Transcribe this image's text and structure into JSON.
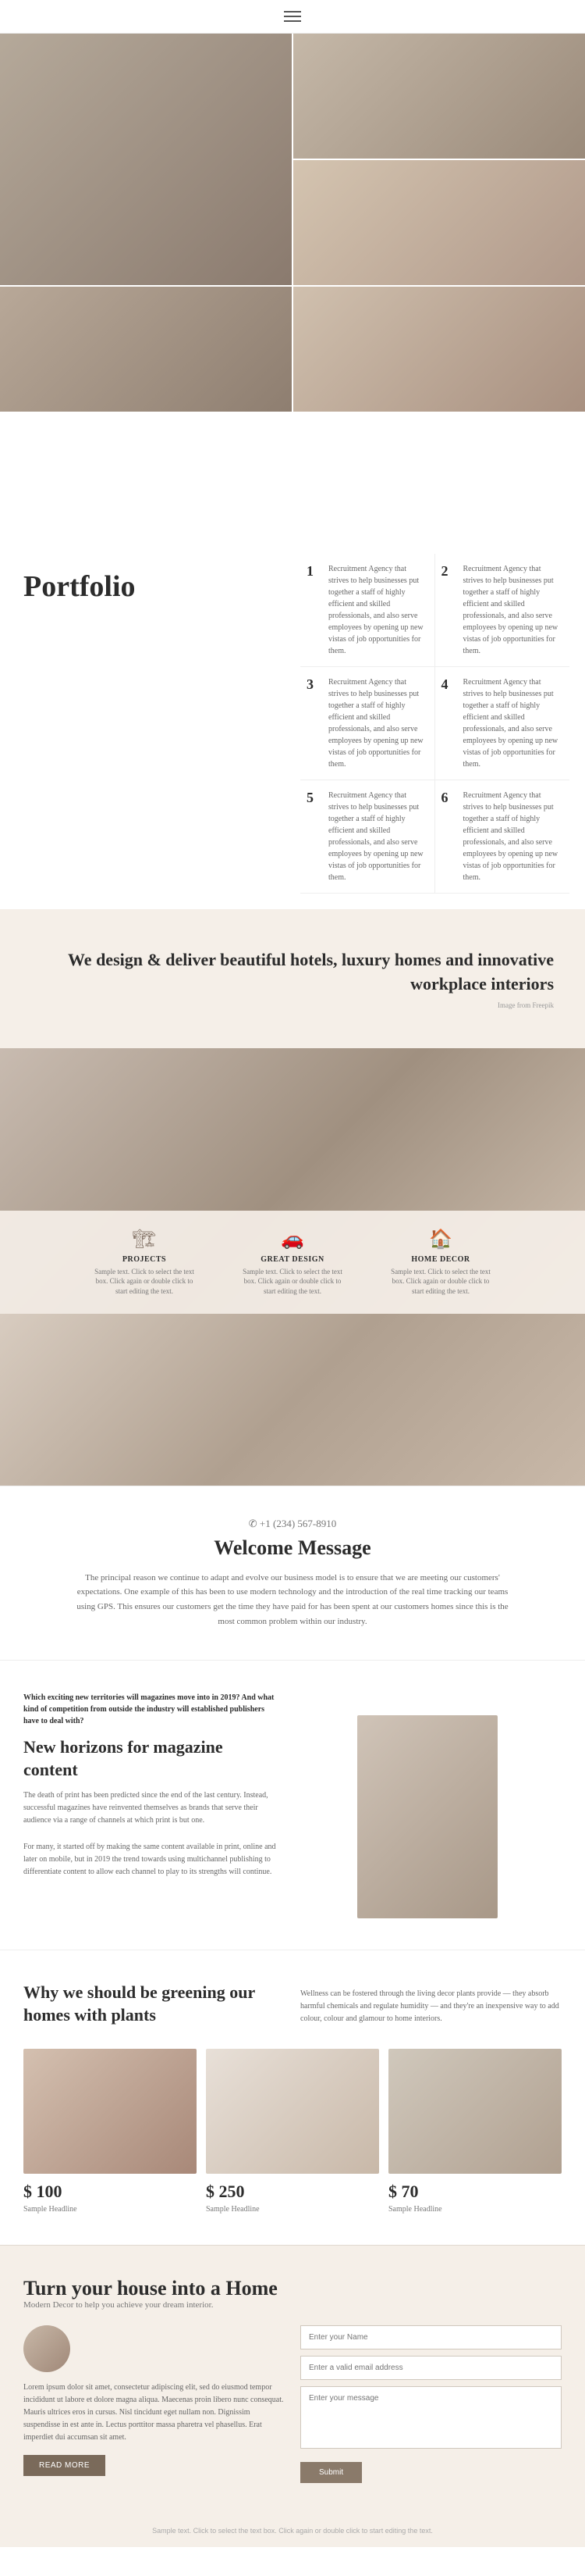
{
  "nav": {
    "menu_icon_label": "menu"
  },
  "hero": {
    "cells": [
      {
        "id": "cell-1",
        "class": "img-1"
      },
      {
        "id": "cell-2",
        "class": "img-2"
      },
      {
        "id": "cell-3",
        "class": "img-3"
      },
      {
        "id": "cell-4",
        "class": "img-4"
      }
    ]
  },
  "portfolio": {
    "title": "Portfolio",
    "items": [
      {
        "num": "1",
        "text": "Recruitment Agency that strives to help businesses put together a staff of highly efficient and skilled professionals, and also serve employees by opening up new vistas of job opportunities for them."
      },
      {
        "num": "2",
        "text": "Recruitment Agency that strives to help businesses put together a staff of highly efficient and skilled professionals, and also serve employees by opening up new vistas of job opportunities for them."
      },
      {
        "num": "3",
        "text": "Recruitment Agency that strives to help businesses put together a staff of highly efficient and skilled professionals, and also serve employees by opening up new vistas of job opportunities for them."
      },
      {
        "num": "4",
        "text": "Recruitment Agency that strives to help businesses put together a staff of highly efficient and skilled professionals, and also serve employees by opening up new vistas of job opportunities for them."
      },
      {
        "num": "5",
        "text": "Recruitment Agency that strives to help businesses put together a staff of highly efficient and skilled professionals, and also serve employees by opening up new vistas of job opportunities for them."
      },
      {
        "num": "6",
        "text": "Recruitment Agency that strives to help businesses put together a staff of highly efficient and skilled professionals, and also serve employees by opening up new vistas of job opportunities for them."
      }
    ]
  },
  "design_banner": {
    "heading": "We design & deliver beautiful hotels, luxury homes and innovative workplace interiors",
    "attribution": "Image from Freepik"
  },
  "icons_section": {
    "items": [
      {
        "id": "projects",
        "icon": "🏗",
        "label": "PROJECTS",
        "text": "Sample text. Click to select the text box. Click again or double click to start editing the text."
      },
      {
        "id": "great-design",
        "icon": "🚗",
        "label": "GREAT DESIGN",
        "text": "Sample text. Click to select the text box. Click again or double click to start editing the text."
      },
      {
        "id": "home-decor",
        "icon": "🏠",
        "label": "HOME DECOR",
        "text": "Sample text. Click to select the text box. Click again or double click to start editing the text."
      }
    ]
  },
  "welcome": {
    "phone": "✆ +1 (234) 567-8910",
    "title": "Welcome Message",
    "text": "The principal reason we continue to adapt and evolve our business model is to ensure that we are meeting our customers' expectations. One example of this has been to use modern technology and the introduction of the real time tracking our teams using GPS. This ensures our customers get the time they have paid for has been spent at our customers homes since this is the most common problem within our industry."
  },
  "magazine": {
    "intro": "Which exciting new territories will magazines move into in 2019? And what kind of competition from outside the industry will established publishers have to deal with?",
    "title": "New horizons for magazine content",
    "body1": "The death of print has been predicted since the end of the last century. Instead, successful magazines have reinvented themselves as brands that serve their audience via a range of channels at which print is but one.",
    "body2": "For many, it started off by making the same content available in print, online and later on mobile, but in 2019 the trend towards using multichannel publishing to differentiate content to allow each channel to play to its strengths will continue."
  },
  "plants": {
    "title": "Why we should be greening our homes with plants",
    "description": "Wellness can be fostered through the living decor plants provide — they absorb harmful chemicals and regulate humidity — and they're an inexpensive way to add colour, colour and glamour to home interiors.",
    "items": [
      {
        "price": "$ 100",
        "label": "Sample Headline"
      },
      {
        "price": "$ 250",
        "label": "Sample Headline"
      },
      {
        "price": "$ 70",
        "label": "Sample Headline"
      }
    ]
  },
  "home_section": {
    "title": "Turn your house into a Home",
    "subtitle": "Modern Decor to help you achieve your dream interior.",
    "body": "Lorem ipsum dolor sit amet, consectetur adipiscing elit, sed do eiusmod tempor incididunt ut labore et dolore magna aliqua. Maecenas proin libero nunc consequat. Mauris ultrices eros in cursus. Nisl tincidunt eget nullam non. Dignissim suspendisse in est ante in. Lectus porttitor massa pharetra vel phasellus. Erat imperdiet dui accumsan sit amet.",
    "read_more": "READ MORE",
    "form": {
      "name_placeholder": "Enter your Name",
      "email_placeholder": "Enter a valid email address",
      "message_placeholder": "Enter your message",
      "submit_label": "Submit"
    }
  },
  "footer": {
    "sample_text": "Sample text. Click to select the text box. Click again or double click to start editing the text."
  }
}
